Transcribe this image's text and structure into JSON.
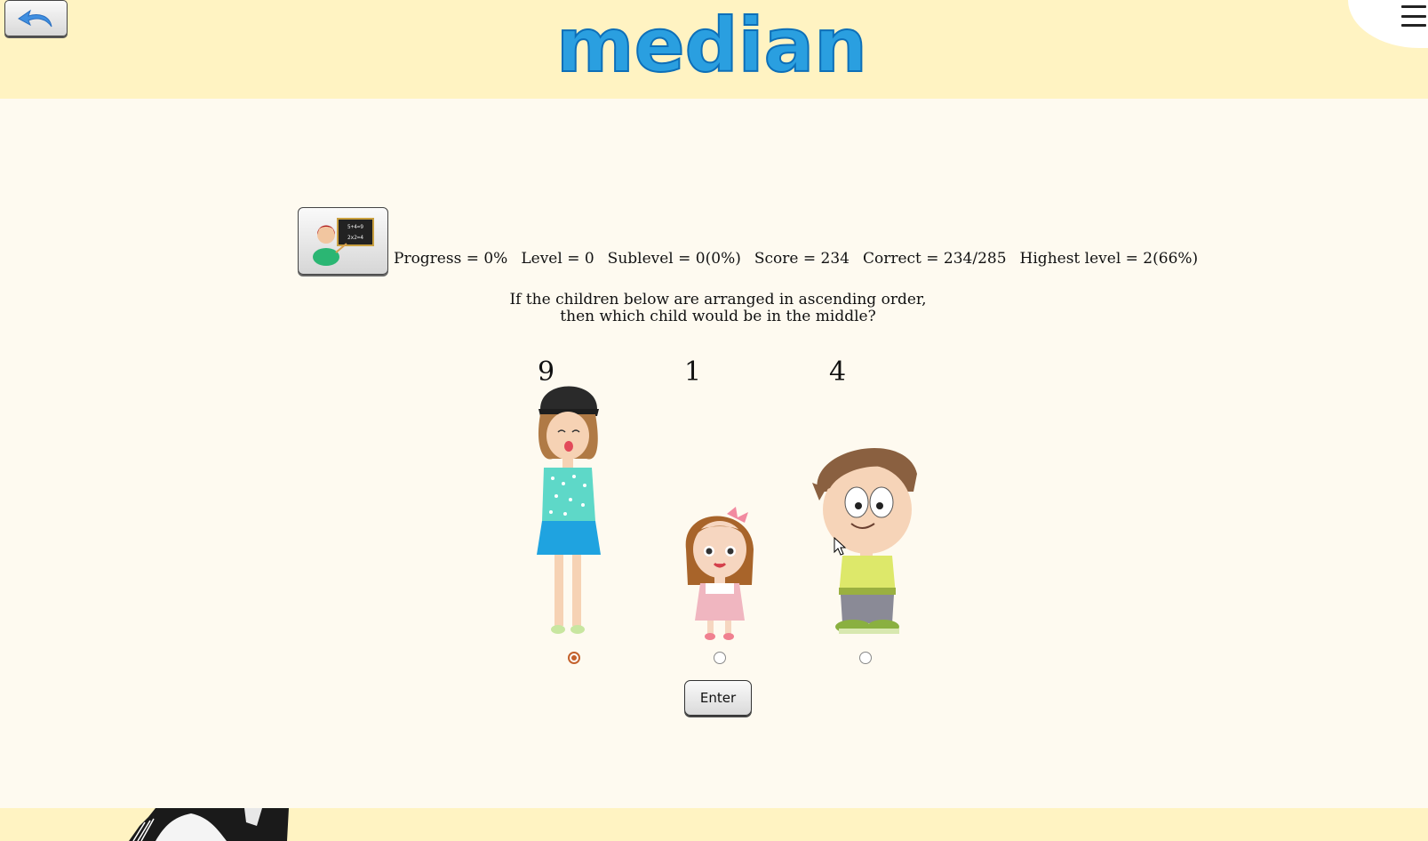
{
  "header": {
    "logo_text": "median",
    "back_icon": "undo-arrow-icon",
    "menu_icon": "hamburger-menu-icon"
  },
  "stats": {
    "progress": "Progress = 0%",
    "level": "Level = 0",
    "sublevel": "Sublevel = 0(0%)",
    "score": "Score = 234",
    "correct": "Correct = 234/285",
    "highest_level": "Highest level = 2(66%)"
  },
  "question": {
    "line1": "If the children below are arranged in ascending order,",
    "line2": "then which child would be in the middle?"
  },
  "children": [
    {
      "number": "9",
      "figure": "tall-girl-with-hat",
      "selected": true
    },
    {
      "number": "1",
      "figure": "small-girl-with-bow",
      "selected": false
    },
    {
      "number": "4",
      "figure": "boy",
      "selected": false
    }
  ],
  "enter_button": "Enter",
  "colors": {
    "band": "#fff3c2",
    "background": "#fefaf0",
    "logo_blue": "#29a9e6",
    "radio_selected": "#c4622d"
  }
}
